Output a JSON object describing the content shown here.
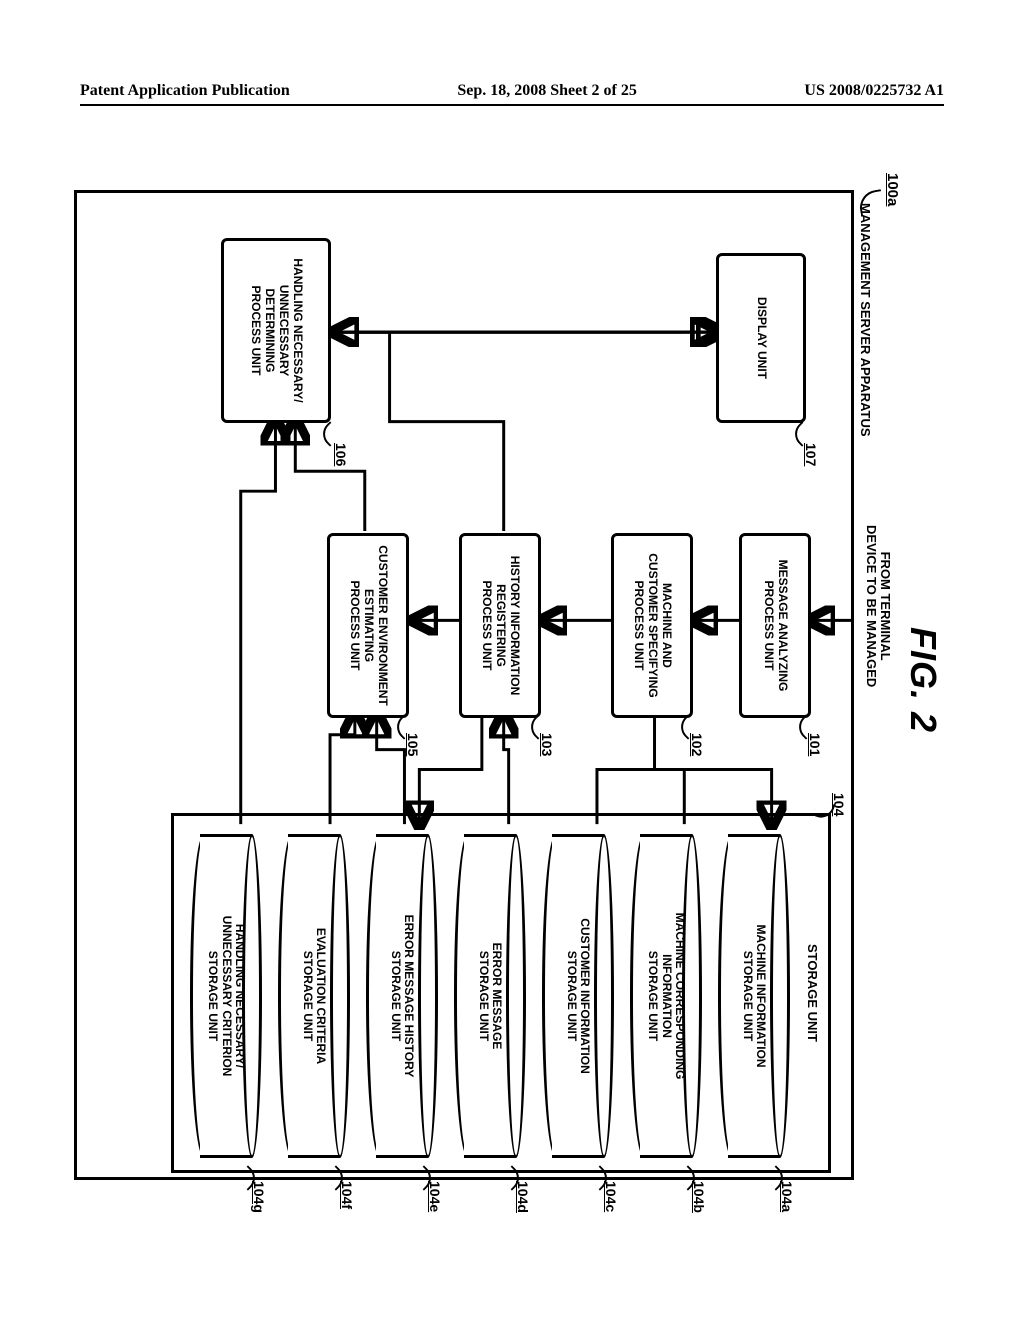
{
  "header": {
    "left": "Patent Application Publication",
    "center": "Sep. 18, 2008  Sheet 2 of 25",
    "right": "US 2008/0225732 A1"
  },
  "figure": {
    "title": "FIG. 2",
    "input_label": "FROM TERMINAL\nDEVICE TO BE MANAGED",
    "apparatus": {
      "ref": "100a",
      "label": "MANAGEMENT SERVER APPARATUS"
    },
    "blocks": {
      "b101": {
        "ref": "101",
        "label": "MESSAGE ANALYZING\nPROCESS UNIT"
      },
      "b102": {
        "ref": "102",
        "label": "MACHINE AND\nCUSTOMER SPECIFYING\nPROCESS UNIT"
      },
      "b103": {
        "ref": "103",
        "label": "HISTORY INFORMATION\nREGISTERING\nPROCESS UNIT"
      },
      "b105": {
        "ref": "105",
        "label": "CUSTOMER ENVIRONMENT\nESTIMATING\nPROCESS UNIT"
      },
      "b106": {
        "ref": "106",
        "label": "HANDLING NECESSARY/\nUNNECESSARY\nDETERMINING\nPROCESS UNIT"
      },
      "b107": {
        "ref": "107",
        "label": "DISPLAY UNIT"
      }
    },
    "storage": {
      "ref": "104",
      "label": "STORAGE UNIT",
      "units": {
        "u104a": {
          "ref": "104a",
          "label": "MACHINE INFORMATION\nSTORAGE UNIT"
        },
        "u104b": {
          "ref": "104b",
          "label": "MACHINE CORRESPONDING\nINFORMATION\nSTORAGE UNIT"
        },
        "u104c": {
          "ref": "104c",
          "label": "CUSTOMER INFORMATION\nSTORAGE UNIT"
        },
        "u104d": {
          "ref": "104d",
          "label": "ERROR MESSAGE\nSTORAGE UNIT"
        },
        "u104e": {
          "ref": "104e",
          "label": "ERROR MESSAGE HISTORY\nSTORAGE UNIT"
        },
        "u104f": {
          "ref": "104f",
          "label": "EVALUATION CRITERIA\nSTORAGE UNIT"
        },
        "u104g": {
          "ref": "104g",
          "label": "HANDLING NECESSARY/\nUNNECESSARY CRITERION\nSTORAGE UNIT"
        }
      }
    }
  }
}
